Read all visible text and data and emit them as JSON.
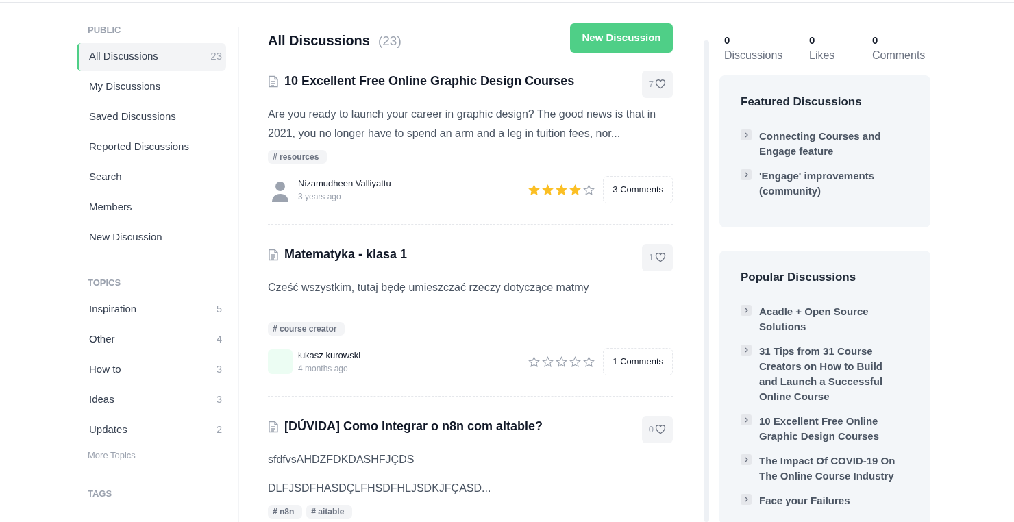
{
  "sidebar": {
    "sections": [
      {
        "heading": "PUBLIC",
        "items": [
          {
            "label": "All Discussions",
            "count": "23",
            "selected": true
          },
          {
            "label": "My Discussions",
            "selected": false
          },
          {
            "label": "Saved Discussions",
            "selected": false
          },
          {
            "label": "Reported Discussions",
            "selected": false
          },
          {
            "label": "Search",
            "selected": false
          },
          {
            "label": "Members",
            "selected": false
          },
          {
            "label": "New Discussion",
            "selected": false
          }
        ]
      },
      {
        "heading": "TOPICS",
        "items": [
          {
            "label": "Inspiration",
            "count": "5",
            "selected": false
          },
          {
            "label": "Other",
            "count": "4",
            "selected": false
          },
          {
            "label": "How to",
            "count": "3",
            "selected": false
          },
          {
            "label": "Ideas",
            "count": "3",
            "selected": false
          },
          {
            "label": "Updates",
            "count": "2",
            "selected": false
          }
        ],
        "more": "More Topics"
      },
      {
        "heading": "TAGS"
      }
    ]
  },
  "main": {
    "title": "All Discussions",
    "count": "(23)",
    "new_button": "New Discussion",
    "discussions": [
      {
        "title": "10 Excellent Free Online Graphic Design Courses",
        "likes": "7",
        "excerpt": [
          "Are you ready to launch your career in graphic design? The good news is that in 2021, you no longer have to spend an arm and a leg in tuition fees, nor..."
        ],
        "tags": [
          "# resources"
        ],
        "author": "Nizamudheen Valliyattu",
        "avatar": {
          "kind": "illustration"
        },
        "time": "3 years ago",
        "stars": 4,
        "comments": "3 Comments"
      },
      {
        "title": "Matematyka - klasa 1",
        "likes": "1",
        "excerpt": [
          "Cześć wszystkim, tutaj będę umieszczać rzeczy dotyczące matmy"
        ],
        "tags": [
          "# course creator"
        ],
        "author": "łukasz kurowski",
        "avatar": {
          "kind": "blank"
        },
        "time": "4 months ago",
        "stars": 0,
        "comments": "1 Comments"
      },
      {
        "title": "[DÚVIDA] Como integrar o n8n com aitable?",
        "likes": "0",
        "excerpt": [
          "sfdfvsAHDZFDKDASHFJÇDS",
          "DLFJSDFHASDÇLFHSDFHLJSDKJFÇASD..."
        ],
        "tags": [
          "# n8n",
          "# aitable"
        ]
      }
    ]
  },
  "stats": [
    {
      "value": "0",
      "label": "Discussions"
    },
    {
      "value": "0",
      "label": "Likes"
    },
    {
      "value": "0",
      "label": "Comments"
    }
  ],
  "panels": [
    {
      "title": "Featured Discussions",
      "items": [
        "Connecting Courses and Engage feature",
        "'Engage' improvements (community)"
      ]
    },
    {
      "title": "Popular Discussions",
      "items": [
        "Acadle + Open Source Solutions",
        "31 Tips from 31 Course Creators on How to Build and Launch a Successful Online Course",
        "10 Excellent Free Online Graphic Design Courses",
        "The Impact Of COVID-19 On The Online Course Industry",
        "Face your Failures"
      ]
    }
  ]
}
